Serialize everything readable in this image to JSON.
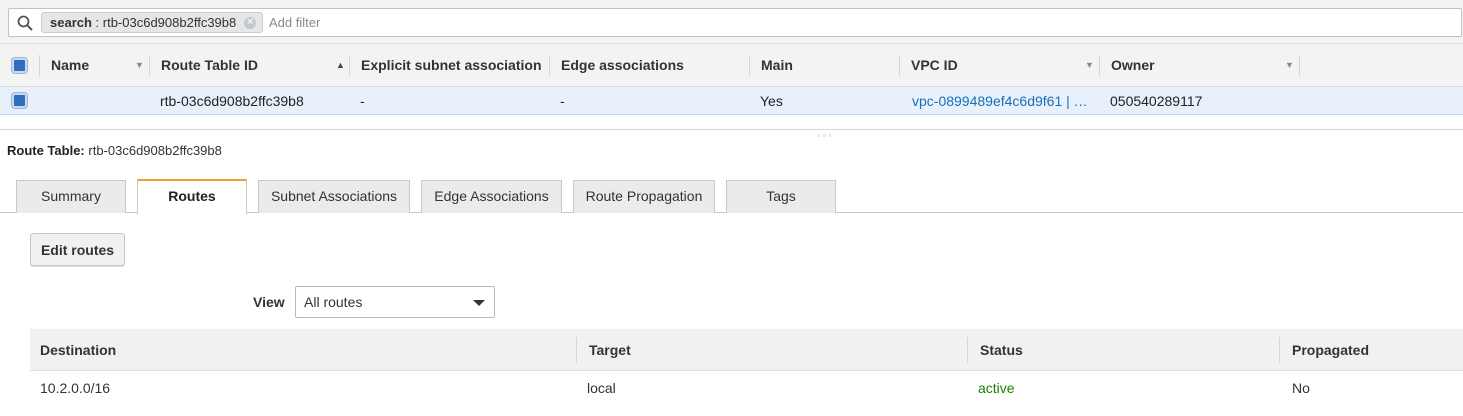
{
  "search": {
    "token_key": "search",
    "token_value": "rtb-03c6d908b2ffc39b8",
    "placeholder": "Add filter"
  },
  "grid": {
    "columns": [
      "Name",
      "Route Table ID",
      "Explicit subnet association",
      "Edge associations",
      "Main",
      "VPC ID",
      "Owner"
    ],
    "rows": [
      {
        "name": "",
        "route_table_id": "rtb-03c6d908b2ffc39b8",
        "explicit_subnet": "-",
        "edge_associations": "-",
        "main": "Yes",
        "vpc_id": "vpc-0899489ef4c6d9f61 | …",
        "owner": "050540289117"
      }
    ]
  },
  "detail": {
    "label": "Route Table:",
    "value": "rtb-03c6d908b2ffc39b8",
    "tabs": [
      "Summary",
      "Routes",
      "Subnet Associations",
      "Edge Associations",
      "Route Propagation",
      "Tags"
    ],
    "active_tab": "Routes",
    "edit_button": "Edit routes",
    "view_label": "View",
    "view_selected": "All routes"
  },
  "routes": {
    "columns": [
      "Destination",
      "Target",
      "Status",
      "Propagated"
    ],
    "rows": [
      {
        "destination": "10.2.0.0/16",
        "target": "local",
        "status": "active",
        "propagated": "No"
      }
    ]
  },
  "colors": {
    "accent_tab": "#f0a030",
    "link": "#1a6fb8",
    "status_active": "#1d8102",
    "selected_row": "#e8f1fb",
    "checkbox": "#2f6dbd"
  }
}
